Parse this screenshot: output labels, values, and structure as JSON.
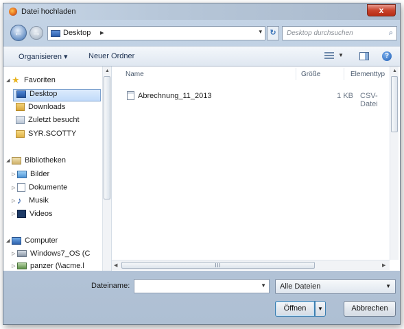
{
  "window": {
    "title": "Datei hochladen",
    "close_glyph": "x"
  },
  "address": {
    "breadcrumb": "Desktop",
    "chevron": "▸",
    "dropdown": "▾",
    "refresh_glyph": "↻"
  },
  "search": {
    "placeholder": "Desktop durchsuchen",
    "icon": "search-icon"
  },
  "toolbar": {
    "organize_label": "Organisieren ▾",
    "new_folder_label": "Neuer Ordner",
    "help_glyph": "?"
  },
  "nav": {
    "favorites": {
      "label": "Favoriten",
      "items": [
        {
          "label": "Desktop",
          "icon": "desktop-icon",
          "selected": true
        },
        {
          "label": "Downloads",
          "icon": "downloads-folder-icon"
        },
        {
          "label": "Zuletzt besucht",
          "icon": "recent-places-icon"
        },
        {
          "label": "SYR.SCOTTY",
          "icon": "user-folder-icon"
        }
      ]
    },
    "libraries": {
      "label": "Bibliotheken",
      "items": [
        {
          "label": "Bilder",
          "icon": "pictures-icon"
        },
        {
          "label": "Dokumente",
          "icon": "documents-icon"
        },
        {
          "label": "Musik",
          "icon": "music-icon"
        },
        {
          "label": "Videos",
          "icon": "videos-icon"
        }
      ]
    },
    "computer": {
      "label": "Computer",
      "items": [
        {
          "label": "Windows7_OS (C",
          "icon": "drive-icon"
        },
        {
          "label": "panzer (\\\\acme.l",
          "icon": "network-drive-icon"
        }
      ]
    }
  },
  "list": {
    "columns": {
      "name": "Name",
      "size": "Größe",
      "type": "Elementtyp"
    },
    "files": [
      {
        "name": "Abrechnung_11_2013",
        "size": "1 KB",
        "type": "CSV-Datei",
        "icon": "csv-file-icon"
      }
    ]
  },
  "footer": {
    "filename_label": "Dateiname:",
    "filename_value": "",
    "filter_value": "Alle Dateien",
    "open_label": "Öffnen",
    "cancel_label": "Abbrechen"
  },
  "colors": {
    "accent": "#2454a0",
    "selection": "#c1dbfa",
    "close": "#c9432c"
  }
}
